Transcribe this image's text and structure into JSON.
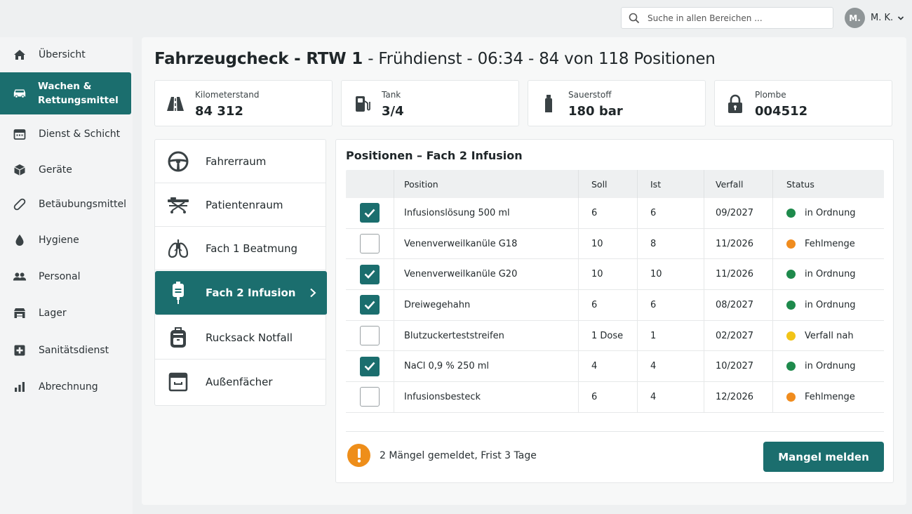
{
  "search": {
    "placeholder": "Suche in allen Bereichen ..."
  },
  "user": {
    "initials": "M.",
    "name": "M. K."
  },
  "sidebar": {
    "items": [
      {
        "label": "Übersicht",
        "icon": "home-icon"
      },
      {
        "label": "Wachen & Rettungsmittel",
        "icon": "ambulance-icon",
        "active": true
      },
      {
        "label": "Dienst & Schicht",
        "icon": "calendar-icon"
      },
      {
        "label": "Geräte",
        "icon": "box-icon"
      },
      {
        "label": "Betäubungsmittel",
        "icon": "pill-icon"
      },
      {
        "label": "Hygiene",
        "icon": "drop-icon"
      },
      {
        "label": "Personal",
        "icon": "people-icon"
      },
      {
        "label": "Lager",
        "icon": "warehouse-icon"
      },
      {
        "label": "Sanitätsdienst",
        "icon": "medical-cross-icon"
      },
      {
        "label": "Abrechnung",
        "icon": "bar-chart-icon"
      }
    ]
  },
  "header": {
    "title_bold": "Fahrzeugcheck - RTW 1",
    "title_rest": " - Frühdienst - 06:34 - 84 von 118 Positionen"
  },
  "stats": [
    {
      "label": "Kilometerstand",
      "value": "84 312",
      "icon": "road-icon"
    },
    {
      "label": "Tank",
      "value": "3/4",
      "icon": "fuel-icon"
    },
    {
      "label": "Sauerstoff",
      "value": "180 bar",
      "icon": "oxygen-bottle-icon"
    },
    {
      "label": "Plombe",
      "value": "004512",
      "icon": "lock-icon"
    }
  ],
  "compartments": [
    {
      "label": "Fahrerraum",
      "icon": "steering-wheel-icon"
    },
    {
      "label": "Patientenraum",
      "icon": "stretcher-icon"
    },
    {
      "label": "Fach 1 Beatmung",
      "icon": "lungs-icon"
    },
    {
      "label": "Fach 2 Infusion",
      "icon": "infusion-bag-icon",
      "active": true
    },
    {
      "label": "Rucksack Notfall",
      "icon": "backpack-icon"
    },
    {
      "label": "Außenfächer",
      "icon": "drawer-icon"
    }
  ],
  "positions": {
    "title": "Positionen – Fach 2 Infusion",
    "columns": [
      "",
      "Position",
      "Soll",
      "Ist",
      "Verfall",
      "Status"
    ],
    "rows": [
      {
        "checked": true,
        "position": "Infusionslösung 500 ml",
        "soll": "6",
        "ist": "6",
        "verfall": "09/2027",
        "status": "in Ordnung",
        "status_color": "#1e8a4c"
      },
      {
        "checked": false,
        "position": "Venenverweilkanüle G18",
        "soll": "10",
        "ist": "8",
        "verfall": "11/2026",
        "status": "Fehlmenge",
        "status_color": "#f08c1e"
      },
      {
        "checked": true,
        "position": "Venenverweilkanüle G20",
        "soll": "10",
        "ist": "10",
        "verfall": "11/2026",
        "status": "in Ordnung",
        "status_color": "#1e8a4c"
      },
      {
        "checked": true,
        "position": "Dreiwegehahn",
        "soll": "6",
        "ist": "6",
        "verfall": "08/2027",
        "status": "in Ordnung",
        "status_color": "#1e8a4c"
      },
      {
        "checked": false,
        "position": "Blutzuckerteststreifen",
        "soll": "1 Dose",
        "ist": "1",
        "verfall": "02/2027",
        "status": "Verfall nah",
        "status_color": "#f2c417"
      },
      {
        "checked": true,
        "position": "NaCl 0,9 % 250 ml",
        "soll": "4",
        "ist": "4",
        "verfall": "10/2027",
        "status": "in Ordnung",
        "status_color": "#1e8a4c"
      },
      {
        "checked": false,
        "position": "Infusionsbesteck",
        "soll": "6",
        "ist": "4",
        "verfall": "12/2026",
        "status": "Fehlmenge",
        "status_color": "#f08c1e"
      }
    ]
  },
  "footer": {
    "warning": "2 Mängel gemeldet, Frist 3 Tage",
    "button": "Mangel melden"
  },
  "colors": {
    "accent": "#1b6e6e",
    "ok": "#1e8a4c",
    "shortage": "#f08c1e",
    "expiring": "#f2c417"
  }
}
